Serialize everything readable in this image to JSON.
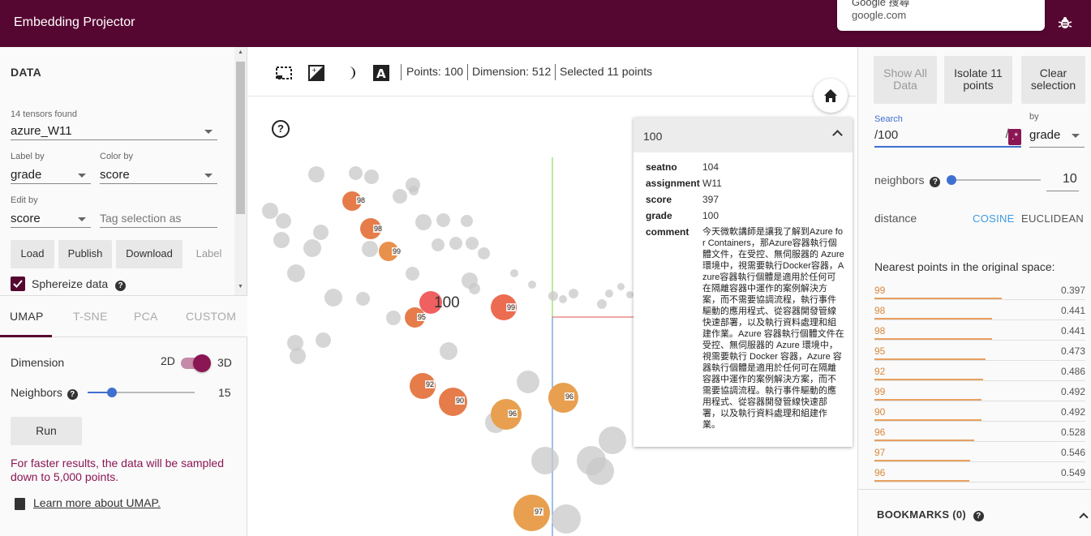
{
  "header": {
    "title": "Embedding Projector",
    "popup_title": "Google 搜尋",
    "popup_url": "google.com"
  },
  "data_panel": {
    "section_title": "DATA",
    "tensors_found": "14 tensors found",
    "tensor_selected": "azure_W11",
    "label_by_label": "Label by",
    "label_by_value": "grade",
    "color_by_label": "Color by",
    "color_by_value": "score",
    "edit_by_label": "Edit by",
    "edit_by_value": "score",
    "tag_placeholder": "Tag selection as",
    "load_label": "Load",
    "publish_label": "Publish",
    "download_label": "Download",
    "label_button": "Label",
    "sphereize_label": "Sphereize data",
    "sphereize_checked": true
  },
  "projection": {
    "tabs": [
      "UMAP",
      "T-SNE",
      "PCA",
      "CUSTOM"
    ],
    "active_tab": "UMAP",
    "dimension_label": "Dimension",
    "dim_2d": "2D",
    "dim_3d": "3D",
    "dimension_selected": "3D",
    "neighbors_label": "Neighbors",
    "neighbors_value": "15",
    "run_label": "Run",
    "warning": "For faster results, the data will be sampled down to 5,000 points.",
    "learn_more": "Learn more about UMAP."
  },
  "toolbar": {
    "points": "Points: 100",
    "dimension": "Dimension: 512",
    "selected": "Selected 11 points"
  },
  "canvas": {
    "selected_label": "100",
    "point_labels": [
      "98",
      "98",
      "99",
      "99",
      "95",
      "92",
      "90",
      "96",
      "96",
      "97"
    ]
  },
  "info_card": {
    "title": "100",
    "fields": [
      {
        "key": "seatno",
        "value": "104"
      },
      {
        "key": "assignment",
        "value": "W11"
      },
      {
        "key": "score",
        "value": "397"
      },
      {
        "key": "grade",
        "value": "100"
      }
    ],
    "comment_key": "comment",
    "comment": "今天微軟講師是讓我了解到Azure for Containers，那Azure容器執行個體文件，在受控、無伺服器的 Azure 環境中，視需要執行Docker容器，Azure容器執行個體是適用於任何可在隔離容器中運作的案例解決方案，而不需要協調流程，執行事件驅動的應用程式、從容器開發管線快速部署，以及執行資料處理和組建作業。Azure 容器執行個體文件在受控、無伺服器的 Azure 環境中，視需要執行 Docker 容器，Azure 容器執行個體是適用於任何可在隔離容器中運作的案例解決方案，而不需要協調流程。執行事件驅動的應用程式、從容器開發管線快速部署，以及執行資料處理和組建作業。"
  },
  "inspector": {
    "show_all": "Show All Data",
    "isolate": "Isolate 11 points",
    "clear": "Clear selection",
    "search_label": "Search",
    "search_value": "/100",
    "search_slash": "/",
    "regex_symbol": ".*",
    "by_label": "by",
    "by_value": "grade",
    "neighbors_label": "neighbors",
    "neighbors_value": "10",
    "distance_label": "distance",
    "cosine": "COSINE",
    "euclidean": "EUCLIDEAN",
    "nearest_title": "Nearest points in the original space:",
    "nearest": [
      {
        "name": "99",
        "dist": "0.397"
      },
      {
        "name": "98",
        "dist": "0.441"
      },
      {
        "name": "98",
        "dist": "0.441"
      },
      {
        "name": "95",
        "dist": "0.473"
      },
      {
        "name": "92",
        "dist": "0.486"
      },
      {
        "name": "99",
        "dist": "0.492"
      },
      {
        "name": "90",
        "dist": "0.492"
      },
      {
        "name": "96",
        "dist": "0.528"
      },
      {
        "name": "97",
        "dist": "0.546"
      },
      {
        "name": "96",
        "dist": "0.549"
      }
    ],
    "bookmarks": "BOOKMARKS (0)"
  },
  "colors": {
    "brand": "#560731",
    "accent": "#3f6fd1",
    "point_grey": "#c8c8c8",
    "point_orange": "#e8a050",
    "point_red": "#f06060"
  }
}
